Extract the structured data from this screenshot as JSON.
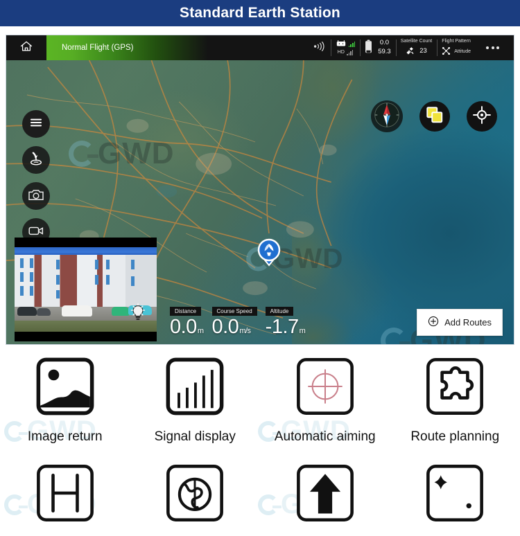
{
  "page": {
    "title": "Standard Earth Station",
    "title_bar_color": "#1b3d80",
    "title_text_color": "#ffffff"
  },
  "app": {
    "status_bar": {
      "home_icon": "home-icon",
      "flight_mode": "Normal Flight (GPS)",
      "flight_mode_accent": "#5bb524",
      "rc_signal_icon": "remote-controller-icon",
      "rc_signal_label": "HD",
      "transmission_icon": "wifi-signal-icon",
      "battery_icon": "battery-icon",
      "battery_voltage": "0.0",
      "battery_percent": "59.3",
      "satellite": {
        "label": "Satellite Count",
        "icon": "satellite-icon",
        "value": "23"
      },
      "flight_pattern": {
        "label": "Flight Pattern",
        "icon": "propeller-icon",
        "value": "Attitude"
      },
      "more_icon": "more-options-icon"
    },
    "map": {
      "watermark": "GWD",
      "left_tools": [
        {
          "name": "menu-icon",
          "label": "Menu"
        },
        {
          "name": "landing-icon",
          "label": "Land"
        },
        {
          "name": "camera-icon",
          "label": "Photo"
        },
        {
          "name": "video-camera-icon",
          "label": "Record"
        }
      ],
      "right_tools": [
        {
          "name": "compass-icon",
          "label": "Compass"
        },
        {
          "name": "map-layers-icon",
          "label": "Map Layers"
        },
        {
          "name": "recenter-icon",
          "label": "Recenter"
        }
      ],
      "drone_marker": "drone-position-icon",
      "pip": {
        "name": "video-preview",
        "bulb_icon": "light-bulb-icon"
      },
      "telemetry": [
        {
          "label": "Distance",
          "value": "0.0",
          "unit": "m"
        },
        {
          "label": "Course Speed",
          "value": "0.0",
          "unit": "m/s"
        },
        {
          "label": "Altitude",
          "value": "-1.7",
          "unit": "m"
        }
      ],
      "add_routes": {
        "label": "Add Routes",
        "icon": "plus-circle-icon"
      }
    }
  },
  "features": [
    {
      "icon": "image-return-icon",
      "label": "Image return"
    },
    {
      "icon": "signal-display-icon",
      "label": "Signal display"
    },
    {
      "icon": "automatic-aiming-icon",
      "label": "Automatic aiming"
    },
    {
      "icon": "route-planning-icon",
      "label": "Route planning"
    },
    {
      "icon": "gimbal-icon",
      "label": ""
    },
    {
      "icon": "globe-icon",
      "label": ""
    },
    {
      "icon": "arrow-up-icon",
      "label": ""
    },
    {
      "icon": "waypoint-icon",
      "label": ""
    }
  ],
  "watermarks": {
    "text": "GWD"
  }
}
